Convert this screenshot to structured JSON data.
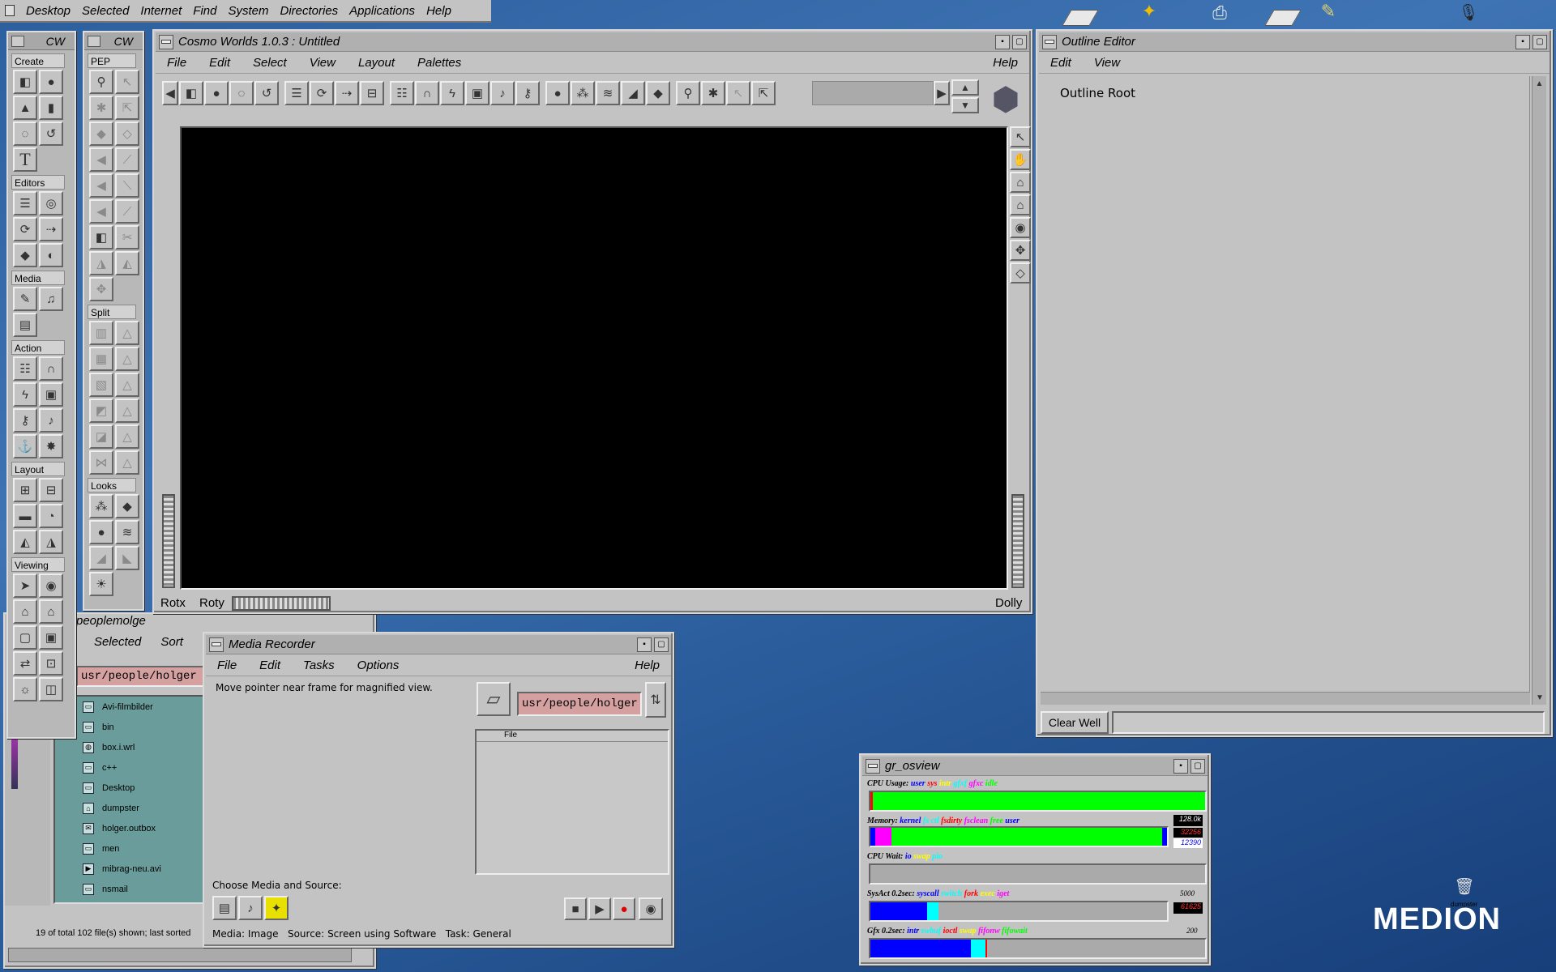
{
  "desktop_menu": {
    "items": [
      "Desktop",
      "Selected",
      "Internet",
      "Find",
      "System",
      "Directories",
      "Applications",
      "Help"
    ]
  },
  "desktop": {
    "brand": "MEDION",
    "dumpster_label": "dumpster"
  },
  "palette_cw": {
    "title": "CW",
    "sections": [
      "Create",
      "Editors",
      "Media",
      "Action",
      "Layout",
      "Viewing"
    ]
  },
  "palette_pep": {
    "title": "CW",
    "sections": [
      "PEP",
      "Split",
      "Looks"
    ]
  },
  "cosmo": {
    "title": "Cosmo Worlds 1.0.3 : Untitled",
    "menu": [
      "File",
      "Edit",
      "Select",
      "View",
      "Layout",
      "Palettes"
    ],
    "help": "Help",
    "rotx": "Rotx",
    "roty": "Roty",
    "dolly": "Dolly"
  },
  "outline": {
    "title": "Outline Editor",
    "menu": [
      "Edit",
      "View"
    ],
    "root": "Outline Root",
    "clear_well": "Clear Well"
  },
  "filemgr": {
    "menu": [
      "Selected",
      "Sort"
    ],
    "path": "usr/people/holger",
    "partial_title": "peoplemolge",
    "files": [
      "Avi-filmbilder",
      "bin",
      "box.i.wrl",
      "c++",
      "Desktop",
      "dumpster",
      "holger.outbox",
      "men",
      "mibrag-neu.avi",
      "nsmail"
    ],
    "status": "19 of total 102 file(s) shown; last sorted"
  },
  "recorder": {
    "title": "Media Recorder",
    "menu": [
      "File",
      "Edit",
      "Tasks",
      "Options"
    ],
    "help": "Help",
    "hint": "Move pointer near frame for magnified view.",
    "path": "usr/people/holger",
    "file_col": "File",
    "choose": "Choose Media and Source:",
    "media_label": "Media:",
    "media_value": "Image",
    "source_label": "Source:",
    "source_value": "Screen using Software",
    "task_label": "Task:",
    "task_value": "General"
  },
  "osview": {
    "title": "gr_osview",
    "cpu_label": "CPU Usage:",
    "cpu_legend": [
      "user",
      "sys",
      "intr",
      "gfxf",
      "gfxc",
      "idle"
    ],
    "mem_label": "Memory:",
    "mem_legend": [
      "kernel",
      "fs ctl",
      "fsdirty",
      "fsclean",
      "free",
      "user"
    ],
    "mem_total": "128.0k",
    "mem_v1": "32256",
    "mem_v2": "12390",
    "wait_label": "CPU Wait:",
    "wait_legend": [
      "io",
      "swap",
      "pio"
    ],
    "sys_label": "SysAct 0.2sec:",
    "sys_legend": [
      "syscall",
      "switch",
      "fork",
      "exec",
      "iget"
    ],
    "sys_max": "5000",
    "sys_val": "61625",
    "gfx_label": "Gfx 0.2sec:",
    "gfx_legend": [
      "intr",
      "swbuf",
      "ioctl",
      "swap",
      "fifonw",
      "fifowait"
    ],
    "gfx_max": "200"
  },
  "colors": {
    "cpu_user": "#00ff00",
    "mem_free": "#00ff00",
    "mem_kernel": "#ff00ff",
    "sys_blue": "#0000ff",
    "sys_cyan": "#00ffff"
  }
}
